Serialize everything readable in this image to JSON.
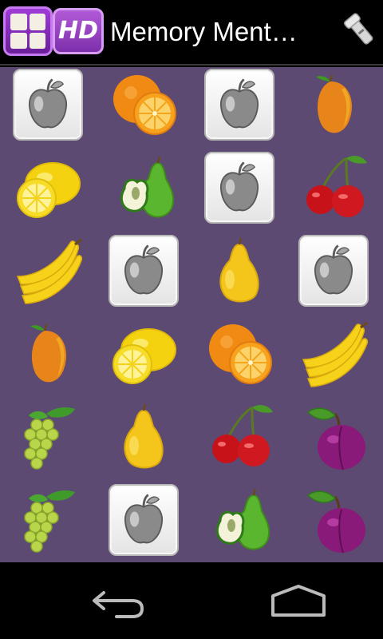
{
  "action_bar": {
    "app_title": "Memory Ment…",
    "hd_label": "HD",
    "settings_icon": "flashlight-settings-icon"
  },
  "board": {
    "cards": [
      {
        "state": "face-down"
      },
      {
        "state": "face-up",
        "fruit": "orange"
      },
      {
        "state": "face-down"
      },
      {
        "state": "face-up",
        "fruit": "mango"
      },
      {
        "state": "face-up",
        "fruit": "lemon"
      },
      {
        "state": "face-up",
        "fruit": "pear-half"
      },
      {
        "state": "face-down"
      },
      {
        "state": "face-up",
        "fruit": "cherries"
      },
      {
        "state": "face-up",
        "fruit": "banana"
      },
      {
        "state": "face-down"
      },
      {
        "state": "face-up",
        "fruit": "pear"
      },
      {
        "state": "face-down"
      },
      {
        "state": "face-up",
        "fruit": "mango"
      },
      {
        "state": "face-up",
        "fruit": "lemon"
      },
      {
        "state": "face-up",
        "fruit": "orange"
      },
      {
        "state": "face-up",
        "fruit": "banana"
      },
      {
        "state": "face-up",
        "fruit": "grapes"
      },
      {
        "state": "face-up",
        "fruit": "pear"
      },
      {
        "state": "face-up",
        "fruit": "cherries"
      },
      {
        "state": "face-up",
        "fruit": "plum"
      },
      {
        "state": "face-up",
        "fruit": "grapes"
      },
      {
        "state": "face-down"
      },
      {
        "state": "face-up",
        "fruit": "pear-half"
      },
      {
        "state": "face-up",
        "fruit": "plum"
      }
    ]
  },
  "nav_bar": {
    "back_icon": "back-arrow-icon",
    "home_icon": "home-icon"
  },
  "colors": {
    "board_background": "#5d4a72",
    "action_bar": "#000000",
    "logo_purple": "#8e3bc4"
  }
}
